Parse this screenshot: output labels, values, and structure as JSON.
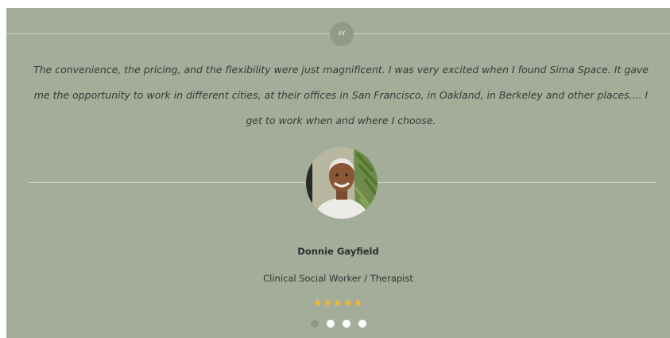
{
  "testimonial": {
    "quote_icon": "quote-icon",
    "quote": "The convenience, the pricing, and the flexibility were just magnificent. I was very excited when I found Sima Space. It gave me the opportunity to work in different cities, at their offices in San Francisco, in Oakland, in Berkeley and other places.... I get to work when and where I choose.",
    "name": "Donnie Gayfield",
    "role": "Clinical Social Worker / Therapist",
    "rating": 5,
    "rating_max": 5,
    "star_glyph": "★",
    "avatar": "person-photo",
    "pagination": {
      "count": 4,
      "active_index": 0
    },
    "colors": {
      "background": "#a3ad9a",
      "star": "#f5b830",
      "dot_active": "#8e978a",
      "dot_inactive": "#ffffff"
    }
  }
}
